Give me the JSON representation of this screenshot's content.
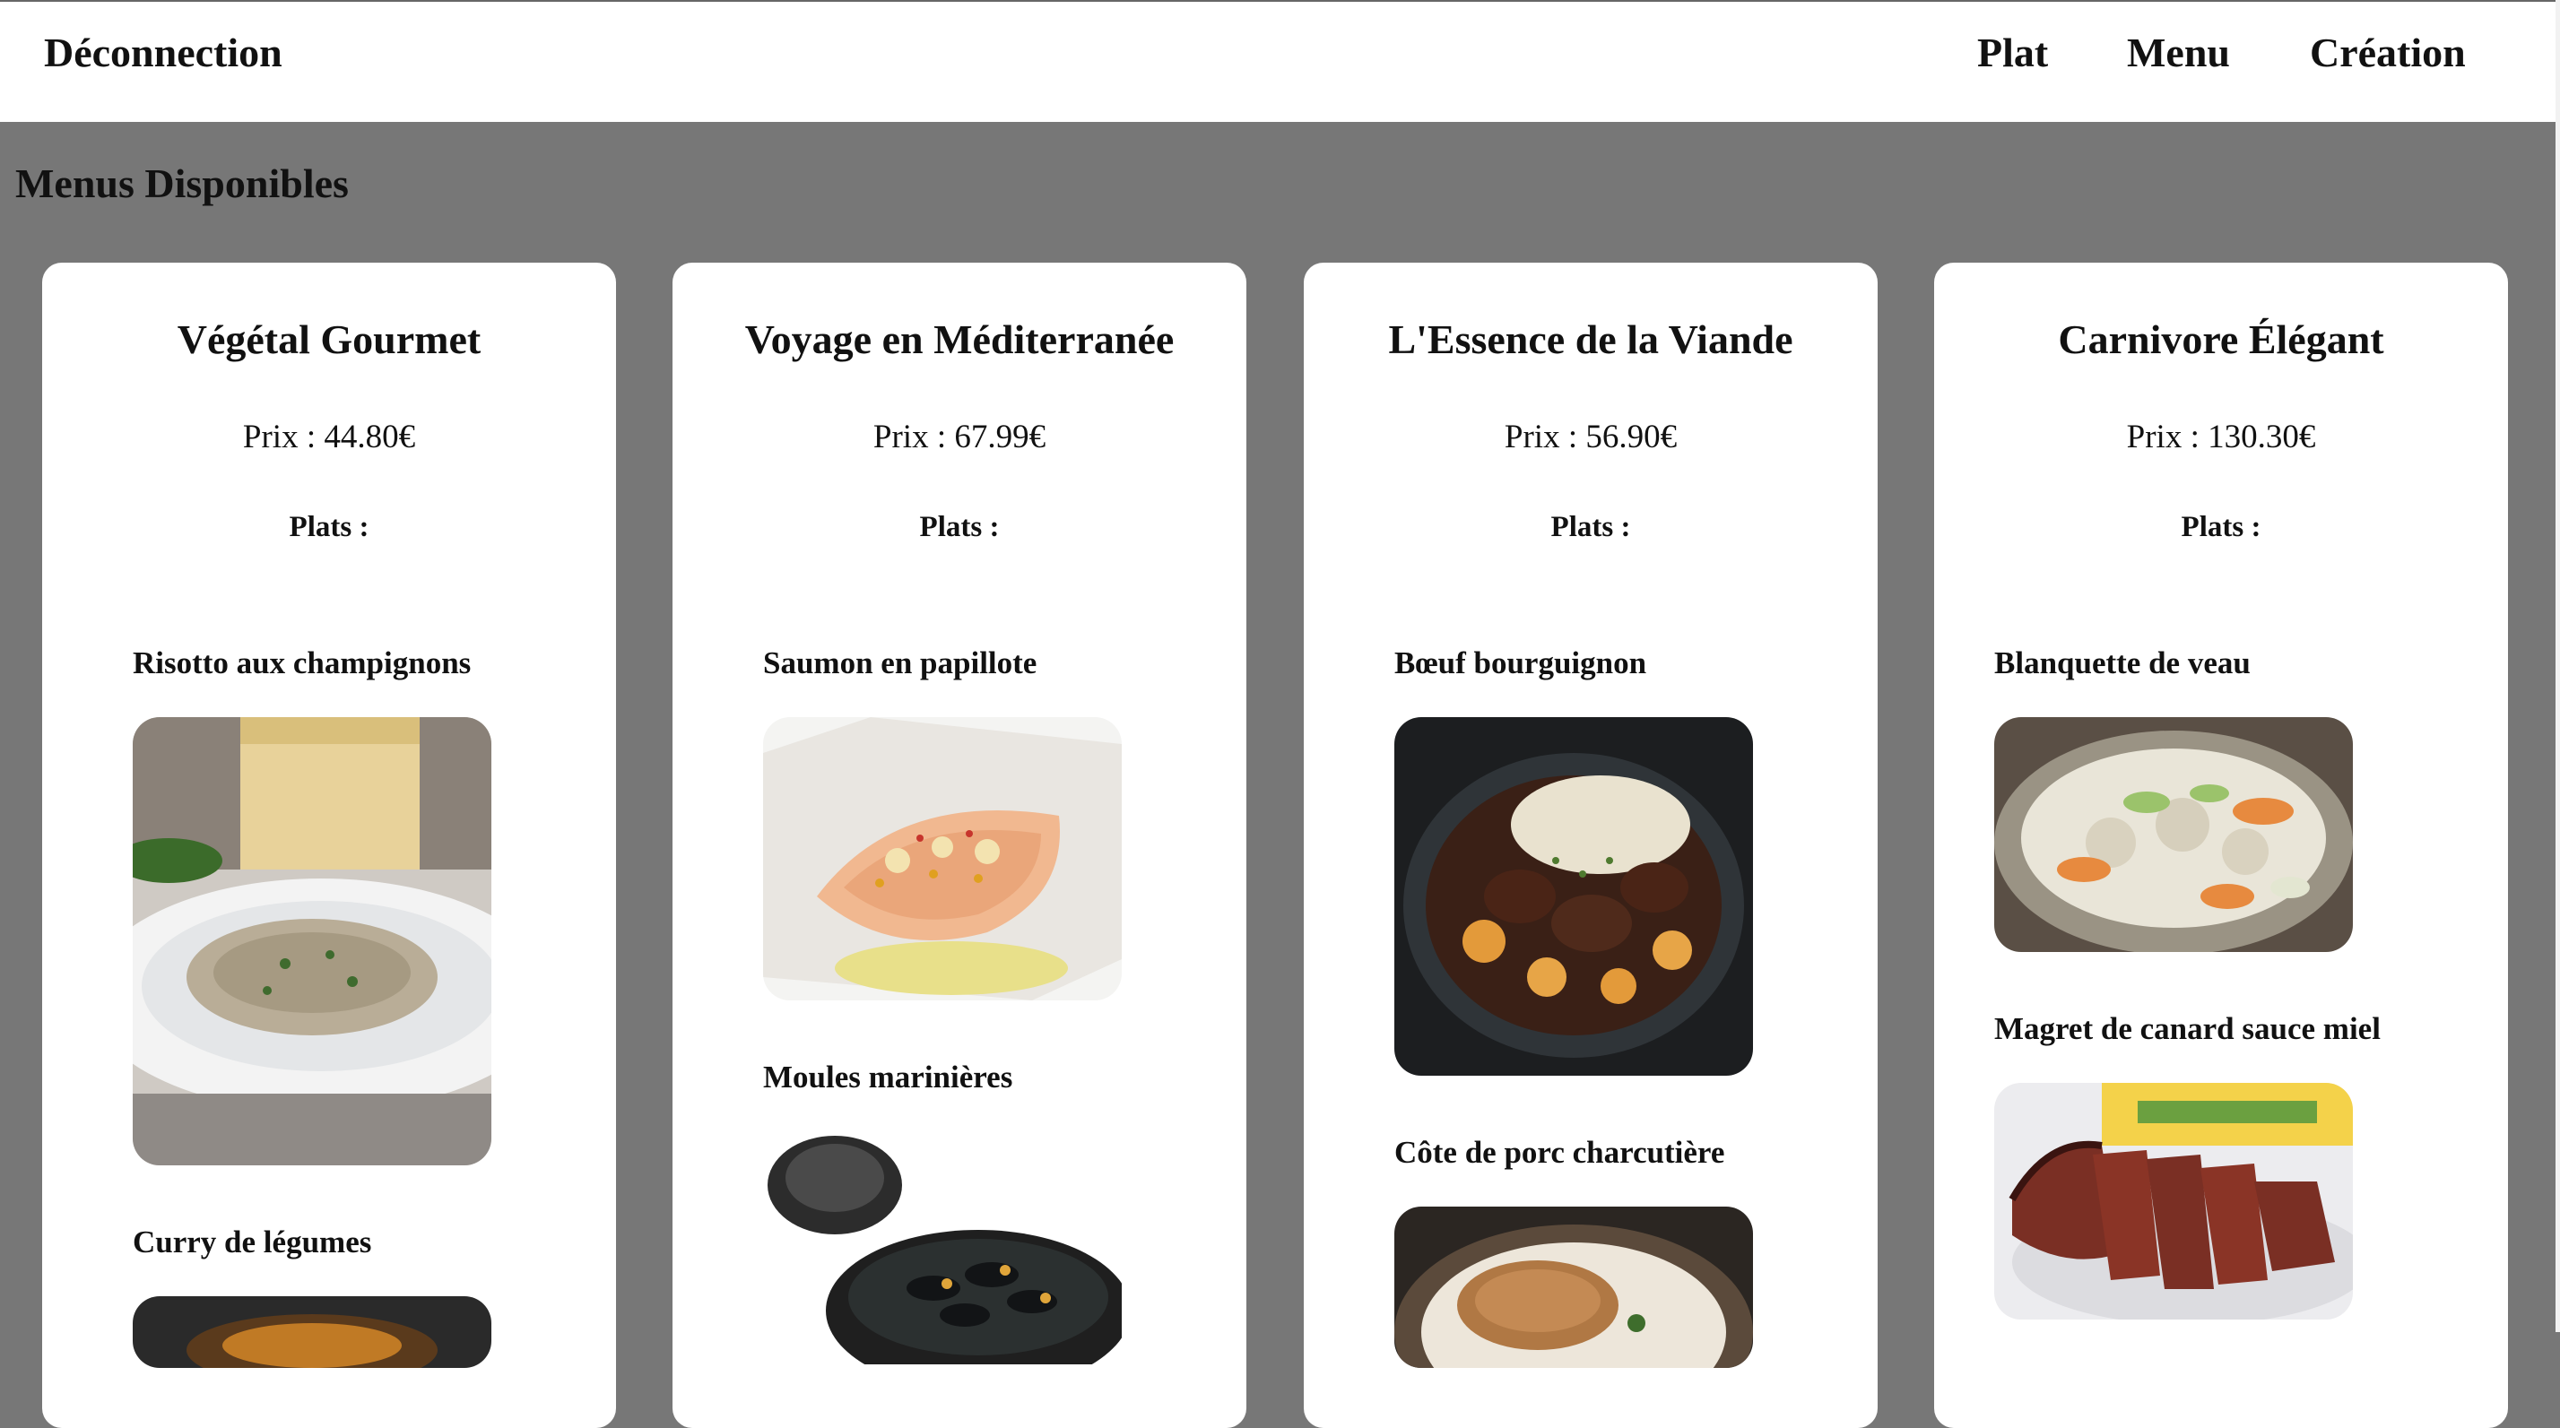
{
  "header": {
    "logout_label": "Déconnection",
    "nav": [
      "Plat",
      "Menu",
      "Création"
    ]
  },
  "page": {
    "section_title": "Menus Disponibles"
  },
  "menus": [
    {
      "title": "Végétal Gourmet",
      "price": "Prix : 44.80€",
      "plats_label": "Plats :",
      "dishes": [
        "Risotto aux champignons",
        "Curry de légumes"
      ]
    },
    {
      "title": "Voyage en Méditerranée",
      "price": "Prix : 67.99€",
      "plats_label": "Plats :",
      "dishes": [
        "Saumon en papillote",
        "Moules marinières"
      ]
    },
    {
      "title": "L'Essence de la Viande",
      "price": "Prix : 56.90€",
      "plats_label": "Plats :",
      "dishes": [
        "Bœuf bourguignon",
        "Côte de porc charcutière"
      ]
    },
    {
      "title": "Carnivore Élégant",
      "price": "Prix : 130.30€",
      "plats_label": "Plats :",
      "dishes": [
        "Blanquette de veau",
        "Magret de canard sauce miel"
      ]
    }
  ]
}
